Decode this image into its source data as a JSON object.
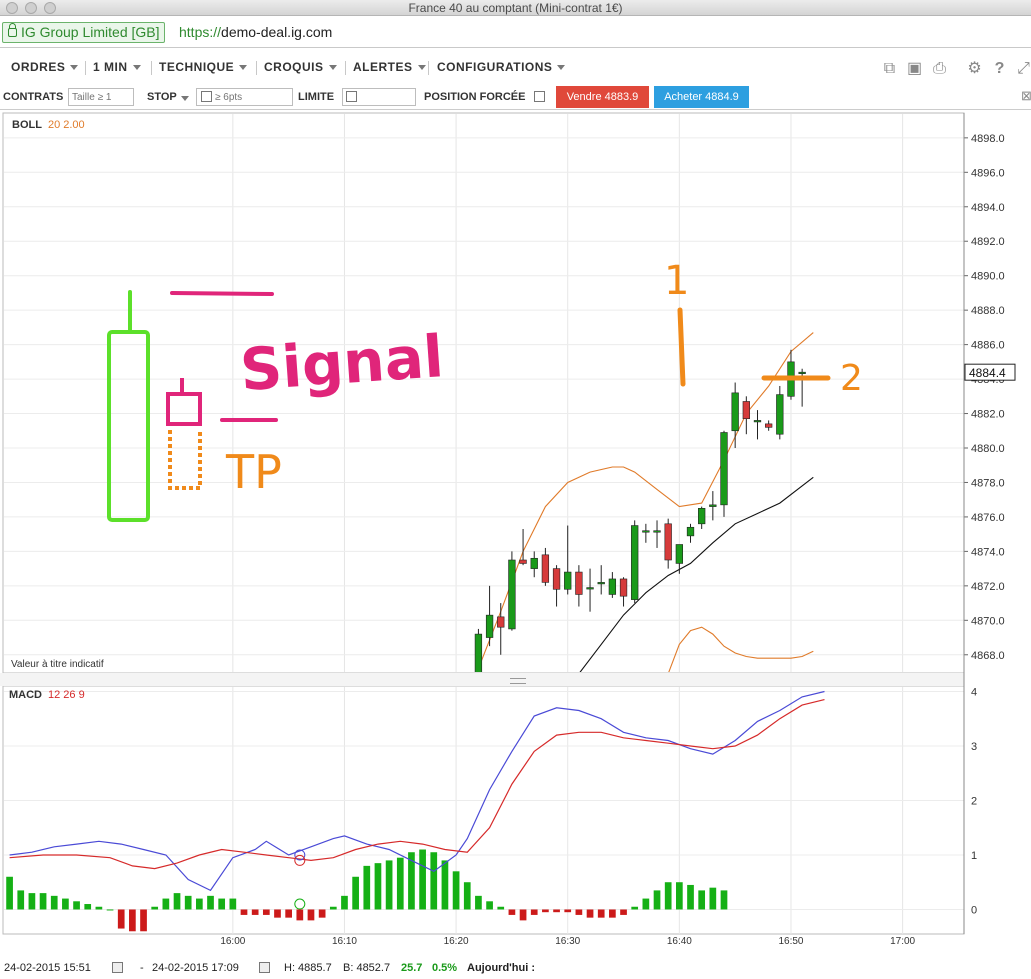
{
  "window": {
    "title": "France 40 au comptant (Mini-contrat 1€)"
  },
  "urlbar": {
    "site_badge": "IG Group Limited [GB]",
    "scheme": "https://",
    "host": "demo-deal.ig.com"
  },
  "menu": {
    "items": [
      "ORDRES",
      "1 MIN",
      "TECHNIQUE",
      "CROQUIS",
      "ALERTES",
      "CONFIGURATIONS"
    ],
    "tools": [
      "layers-icon",
      "image-icon",
      "print-icon",
      "gear-icon",
      "help-icon",
      "expand-icon"
    ]
  },
  "deal": {
    "contracts_label": "CONTRATS",
    "contracts_placeholder": "Taille ≥ 1",
    "stop_label": "STOP",
    "stop_placeholder": "≥ 6pts",
    "limit_label": "LIMITE",
    "forced_label": "POSITION FORCÉE",
    "sell_label": "Vendre 4883.9",
    "buy_label": "Acheter 4884.9"
  },
  "colors": {
    "sell": "#e0483a",
    "buy": "#2d9fe0",
    "up": "#1a9a1a",
    "down": "#d63b3b",
    "boll": "#e07b2a",
    "macd_line": "#4a4ad6",
    "signal_line": "#d62a2a",
    "annotation_pink": "#e0257a",
    "annotation_green": "#5ce02a",
    "annotation_orange": "#f08a1a"
  },
  "indicators": {
    "boll_name": "BOLL",
    "boll_params": "20  2.00",
    "macd_name": "MACD",
    "macd_params": "12  26  9",
    "disclaimer": "Valeur à titre indicatif"
  },
  "current_price": "4884.4",
  "annotations": {
    "signal": "Signal",
    "tp": "TP",
    "one": "1",
    "two": "2"
  },
  "chart_data": [
    {
      "type": "candlestick",
      "title": "",
      "ylim": [
        4867.0,
        4899.5
      ],
      "yticks": [
        4868.0,
        4870.0,
        4872.0,
        4874.0,
        4876.0,
        4878.0,
        4880.0,
        4882.0,
        4884.0,
        4886.0,
        4888.0,
        4890.0,
        4892.0,
        4894.0,
        4896.0,
        4898.0
      ],
      "ytick_labels": [
        "4868.0",
        "4870.0",
        "4872.0",
        "4874.0",
        "4876.0",
        "4878.0",
        "4880.0",
        "4882.0",
        "4884.0",
        "4886.0",
        "4888.0",
        "4890.0",
        "4892.0",
        "4894.0",
        "4896.0",
        "4898.0"
      ],
      "xlim": [
        -20.5,
        65.5
      ],
      "xticks": [
        0,
        10,
        20,
        30,
        40,
        50,
        60
      ],
      "xtick_labels": [
        "16:00",
        "16:10",
        "16:20",
        "16:30",
        "16:40",
        "16:50",
        "17:00"
      ],
      "grid": true,
      "candles": [
        {
          "t": 22,
          "o": 4866.5,
          "h": 4869.5,
          "l": 4866.0,
          "c": 4869.2
        },
        {
          "t": 23,
          "o": 4869.0,
          "h": 4872.0,
          "l": 4868.5,
          "c": 4870.3
        },
        {
          "t": 24,
          "o": 4870.2,
          "h": 4871.0,
          "l": 4868.0,
          "c": 4869.6
        },
        {
          "t": 25,
          "o": 4869.5,
          "h": 4874.0,
          "l": 4869.4,
          "c": 4873.5
        },
        {
          "t": 26,
          "o": 4873.5,
          "h": 4875.3,
          "l": 4873.2,
          "c": 4873.3
        },
        {
          "t": 27,
          "o": 4873.0,
          "h": 4874.0,
          "l": 4872.5,
          "c": 4873.6
        },
        {
          "t": 28,
          "o": 4873.8,
          "h": 4874.2,
          "l": 4872.0,
          "c": 4872.2
        },
        {
          "t": 29,
          "o": 4873.0,
          "h": 4873.2,
          "l": 4870.8,
          "c": 4871.8
        },
        {
          "t": 30,
          "o": 4871.8,
          "h": 4875.5,
          "l": 4871.5,
          "c": 4872.8
        },
        {
          "t": 31,
          "o": 4872.8,
          "h": 4873.2,
          "l": 4870.8,
          "c": 4871.5
        },
        {
          "t": 32,
          "o": 4871.9,
          "h": 4873.0,
          "l": 4870.5,
          "c": 4871.9
        },
        {
          "t": 33,
          "o": 4872.2,
          "h": 4873.2,
          "l": 4871.5,
          "c": 4872.2
        },
        {
          "t": 34,
          "o": 4871.5,
          "h": 4872.8,
          "l": 4871.3,
          "c": 4872.4
        },
        {
          "t": 35,
          "o": 4872.4,
          "h": 4872.5,
          "l": 4870.8,
          "c": 4871.4
        },
        {
          "t": 36,
          "o": 4871.2,
          "h": 4875.8,
          "l": 4871.0,
          "c": 4875.5
        },
        {
          "t": 37,
          "o": 4875.2,
          "h": 4875.6,
          "l": 4874.5,
          "c": 4875.2
        },
        {
          "t": 38,
          "o": 4875.2,
          "h": 4875.8,
          "l": 4874.2,
          "c": 4875.2
        },
        {
          "t": 39,
          "o": 4875.6,
          "h": 4875.9,
          "l": 4873.0,
          "c": 4873.5
        },
        {
          "t": 40,
          "o": 4873.3,
          "h": 4874.4,
          "l": 4872.7,
          "c": 4874.4
        },
        {
          "t": 41,
          "o": 4874.9,
          "h": 4875.6,
          "l": 4874.5,
          "c": 4875.4
        },
        {
          "t": 42,
          "o": 4875.6,
          "h": 4876.6,
          "l": 4875.3,
          "c": 4876.5
        },
        {
          "t": 43,
          "o": 4876.6,
          "h": 4877.5,
          "l": 4875.8,
          "c": 4876.7
        },
        {
          "t": 44,
          "o": 4876.7,
          "h": 4881.0,
          "l": 4876.0,
          "c": 4880.9
        },
        {
          "t": 45,
          "o": 4881.0,
          "h": 4883.8,
          "l": 4880.0,
          "c": 4883.2
        },
        {
          "t": 46,
          "o": 4882.7,
          "h": 4883.0,
          "l": 4880.8,
          "c": 4881.7
        },
        {
          "t": 47,
          "o": 4881.6,
          "h": 4882.2,
          "l": 4880.5,
          "c": 4881.6
        },
        {
          "t": 48,
          "o": 4881.4,
          "h": 4881.6,
          "l": 4881.0,
          "c": 4881.2
        },
        {
          "t": 49,
          "o": 4880.8,
          "h": 4883.6,
          "l": 4880.5,
          "c": 4883.1
        },
        {
          "t": 50,
          "o": 4883.0,
          "h": 4885.7,
          "l": 4882.8,
          "c": 4885.0
        },
        {
          "t": 51,
          "o": 4884.4,
          "h": 4884.6,
          "l": 4882.4,
          "c": 4884.4
        }
      ],
      "series": [
        {
          "name": "BOLL",
          "style": "upper",
          "points": [
            [
              22,
              4867.2
            ],
            [
              24,
              4870.5
            ],
            [
              26,
              4874.0
            ],
            [
              28,
              4876.6
            ],
            [
              30,
              4878.0
            ],
            [
              32,
              4878.6
            ],
            [
              34,
              4878.9
            ],
            [
              35,
              4878.9
            ],
            [
              36,
              4878.6
            ],
            [
              38,
              4877.6
            ],
            [
              40,
              4876.6
            ],
            [
              42,
              4876.8
            ],
            [
              44,
              4879.3
            ],
            [
              46,
              4882.0
            ],
            [
              48,
              4883.6
            ],
            [
              50,
              4885.6
            ],
            [
              52,
              4886.7
            ]
          ]
        },
        {
          "name": "BOLL",
          "style": "middle",
          "points": [
            [
              31,
              4866.9
            ],
            [
              33,
              4868.6
            ],
            [
              35,
              4870.3
            ],
            [
              37,
              4871.6
            ],
            [
              39,
              4872.6
            ],
            [
              41,
              4873.3
            ],
            [
              43,
              4874.5
            ],
            [
              45,
              4875.6
            ],
            [
              47,
              4876.2
            ],
            [
              49,
              4876.8
            ],
            [
              51,
              4877.8
            ],
            [
              52,
              4878.3
            ]
          ]
        },
        {
          "name": "BOLL",
          "style": "lower",
          "points": [
            [
              39,
              4866.9
            ],
            [
              40,
              4868.6
            ],
            [
              41,
              4869.4
            ],
            [
              42,
              4869.6
            ],
            [
              43,
              4869.2
            ],
            [
              44,
              4868.5
            ],
            [
              45,
              4868.1
            ],
            [
              46,
              4867.9
            ],
            [
              47,
              4867.8
            ],
            [
              48,
              4867.8
            ],
            [
              50,
              4867.8
            ],
            [
              51,
              4867.9
            ],
            [
              52,
              4868.2
            ]
          ]
        }
      ]
    },
    {
      "type": "macd",
      "ylim": [
        -0.45,
        4.1
      ],
      "yticks": [
        0,
        1,
        2,
        3,
        4
      ],
      "ytick_labels": [
        "0",
        "1",
        "2",
        "3",
        "4"
      ],
      "xlim": [
        -20.5,
        65.5
      ],
      "series": [
        {
          "name": "MACD",
          "style": "macd",
          "points": [
            [
              -20,
              1.0
            ],
            [
              -18,
              1.05
            ],
            [
              -16,
              1.15
            ],
            [
              -14,
              1.2
            ],
            [
              -12,
              1.25
            ],
            [
              -10,
              1.2
            ],
            [
              -8,
              1.1
            ],
            [
              -6,
              1.0
            ],
            [
              -4,
              0.55
            ],
            [
              -2,
              0.35
            ],
            [
              0,
              0.95
            ],
            [
              2,
              1.1
            ],
            [
              3,
              1.25
            ],
            [
              5,
              1.0
            ],
            [
              7,
              1.15
            ],
            [
              9,
              1.3
            ],
            [
              10,
              1.35
            ],
            [
              12,
              1.2
            ],
            [
              14,
              1.1
            ],
            [
              16,
              0.9
            ],
            [
              18,
              0.7
            ],
            [
              20,
              1.0
            ],
            [
              21,
              1.3
            ],
            [
              23,
              2.2
            ],
            [
              25,
              2.9
            ],
            [
              27,
              3.55
            ],
            [
              29,
              3.7
            ],
            [
              31,
              3.65
            ],
            [
              33,
              3.5
            ],
            [
              35,
              3.25
            ],
            [
              37,
              3.15
            ],
            [
              39,
              3.1
            ],
            [
              41,
              2.95
            ],
            [
              43,
              2.85
            ],
            [
              45,
              3.1
            ],
            [
              47,
              3.45
            ],
            [
              49,
              3.65
            ],
            [
              51,
              3.9
            ],
            [
              53,
              4.0
            ]
          ]
        },
        {
          "name": "Signal",
          "style": "signal",
          "points": [
            [
              -20,
              0.95
            ],
            [
              -17,
              1.0
            ],
            [
              -14,
              1.0
            ],
            [
              -11,
              0.95
            ],
            [
              -9,
              0.8
            ],
            [
              -7,
              0.75
            ],
            [
              -5,
              0.85
            ],
            [
              -3,
              1.0
            ],
            [
              -1,
              1.1
            ],
            [
              1,
              1.05
            ],
            [
              3,
              1.0
            ],
            [
              5,
              0.95
            ],
            [
              7,
              0.9
            ],
            [
              9,
              0.95
            ],
            [
              11,
              1.1
            ],
            [
              13,
              1.2
            ],
            [
              15,
              1.25
            ],
            [
              17,
              1.2
            ],
            [
              19,
              1.1
            ],
            [
              21,
              1.05
            ],
            [
              23,
              1.5
            ],
            [
              25,
              2.3
            ],
            [
              27,
              2.9
            ],
            [
              29,
              3.2
            ],
            [
              31,
              3.25
            ],
            [
              33,
              3.25
            ],
            [
              35,
              3.15
            ],
            [
              37,
              3.1
            ],
            [
              39,
              3.05
            ],
            [
              41,
              3.0
            ],
            [
              43,
              2.95
            ],
            [
              45,
              3.0
            ],
            [
              47,
              3.2
            ],
            [
              49,
              3.5
            ],
            [
              51,
              3.75
            ],
            [
              53,
              3.85
            ]
          ]
        }
      ],
      "histogram": [
        0.6,
        0.35,
        0.3,
        0.3,
        0.25,
        0.2,
        0.15,
        0.1,
        0.05,
        0,
        -0.35,
        -0.4,
        -0.4,
        0.05,
        0.2,
        0.3,
        0.25,
        0.2,
        0.25,
        0.2,
        0.2,
        -0.1,
        -0.1,
        -0.1,
        -0.15,
        -0.15,
        -0.2,
        -0.2,
        -0.15,
        0.05,
        0.25,
        0.6,
        0.8,
        0.85,
        0.9,
        0.95,
        1.05,
        1.1,
        1.05,
        0.9,
        0.7,
        0.5,
        0.25,
        0.15,
        0.05,
        -0.1,
        -0.2,
        -0.1,
        -0.05,
        -0.05,
        -0.05,
        -0.1,
        -0.15,
        -0.15,
        -0.15,
        -0.1,
        0.05,
        0.2,
        0.35,
        0.5,
        0.5,
        0.45,
        0.35,
        0.4,
        0.35
      ]
    }
  ],
  "bottom": {
    "from_date": "24-02-2015 15:51",
    "to_date": "24-02-2015 17:09",
    "high": "H: 4885.7",
    "low": "B: 4852.7",
    "change": "25.7",
    "change_pct": "0.5%",
    "today": "Aujourd'hui :"
  }
}
